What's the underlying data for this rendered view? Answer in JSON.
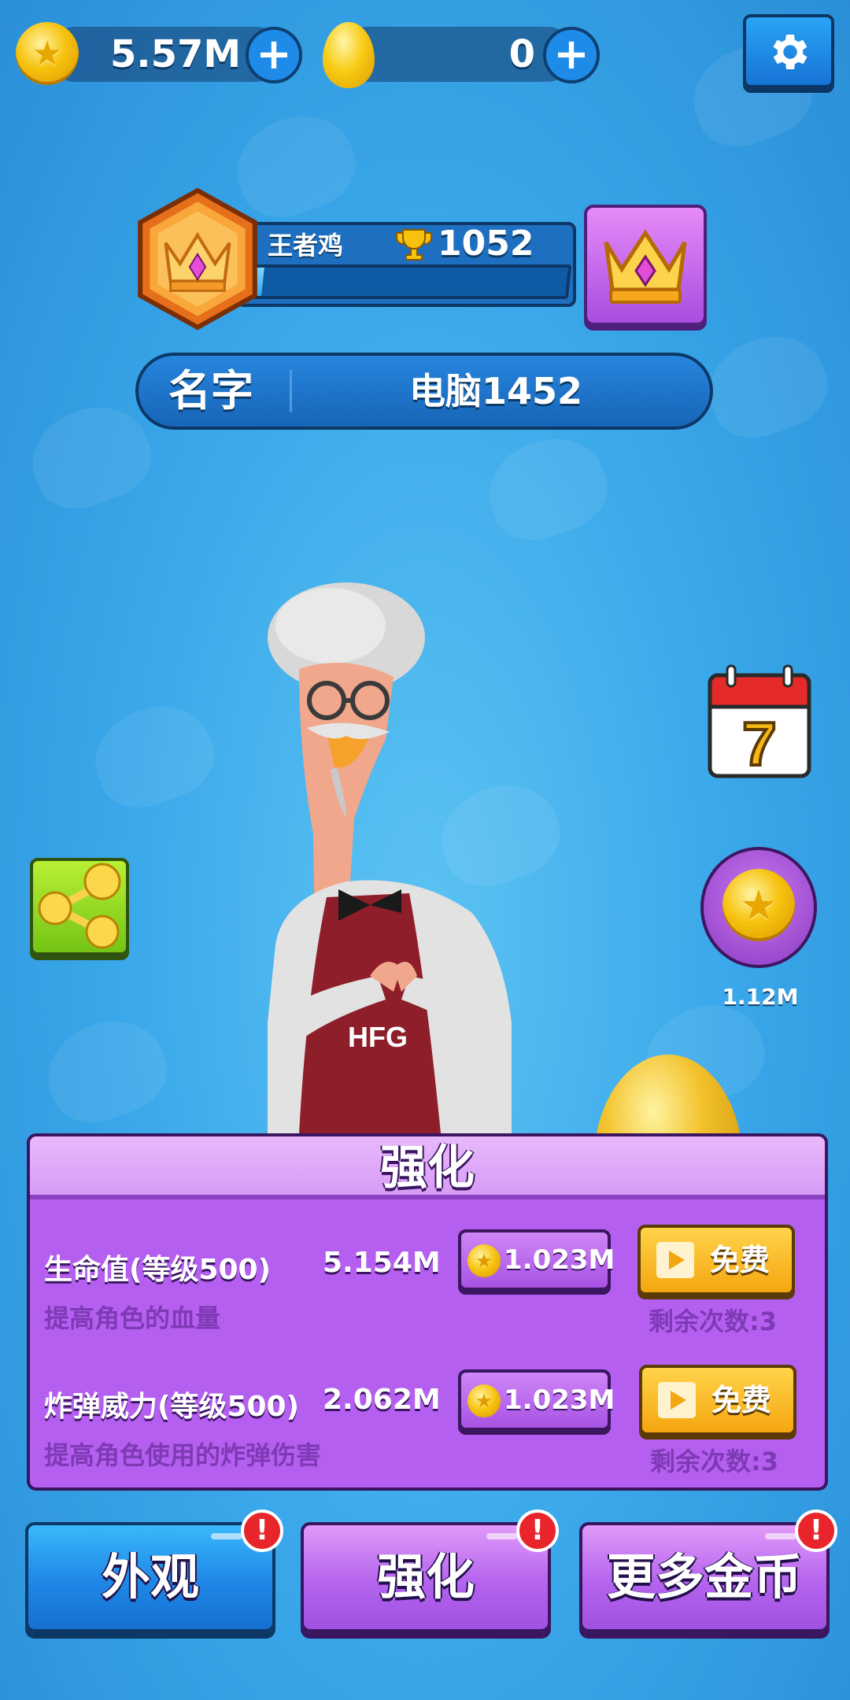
{
  "currency": {
    "coins": "5.57M",
    "eggs": "0"
  },
  "profile": {
    "rank_name": "王者鸡",
    "trophies": "1052",
    "progress": 0.03,
    "name_label": "名字",
    "name_value": "电脑1452"
  },
  "side": {
    "calendar_day": "7",
    "coin_reward": "1.12M"
  },
  "character": {
    "apron_text": "HFG"
  },
  "upgrade_panel": {
    "title": "强化",
    "rows": [
      {
        "label": "生命值(等级500)",
        "value": "5.154M",
        "desc": "提高角色的血量",
        "cost": "1.023M",
        "free_label": "免费",
        "remaining": "剩余次数:3"
      },
      {
        "label": "炸弹威力(等级500)",
        "value": "2.062M",
        "desc": "提高角色使用的炸弹伤害",
        "cost": "1.023M",
        "free_label": "免费",
        "remaining": "剩余次数:3"
      }
    ]
  },
  "tabs": [
    {
      "label": "外观",
      "color": "#1f87e6",
      "alert": "!"
    },
    {
      "label": "强化",
      "color": "#b464ee",
      "alert": "!"
    },
    {
      "label": "更多金币",
      "color": "#b464ee",
      "alert": "!"
    }
  ],
  "icons": [
    "coin-icon",
    "egg-icon",
    "plus-icon",
    "gear-icon",
    "crown-icon",
    "trophy-icon",
    "calendar-icon",
    "share-icon",
    "play-icon",
    "alert-icon"
  ]
}
